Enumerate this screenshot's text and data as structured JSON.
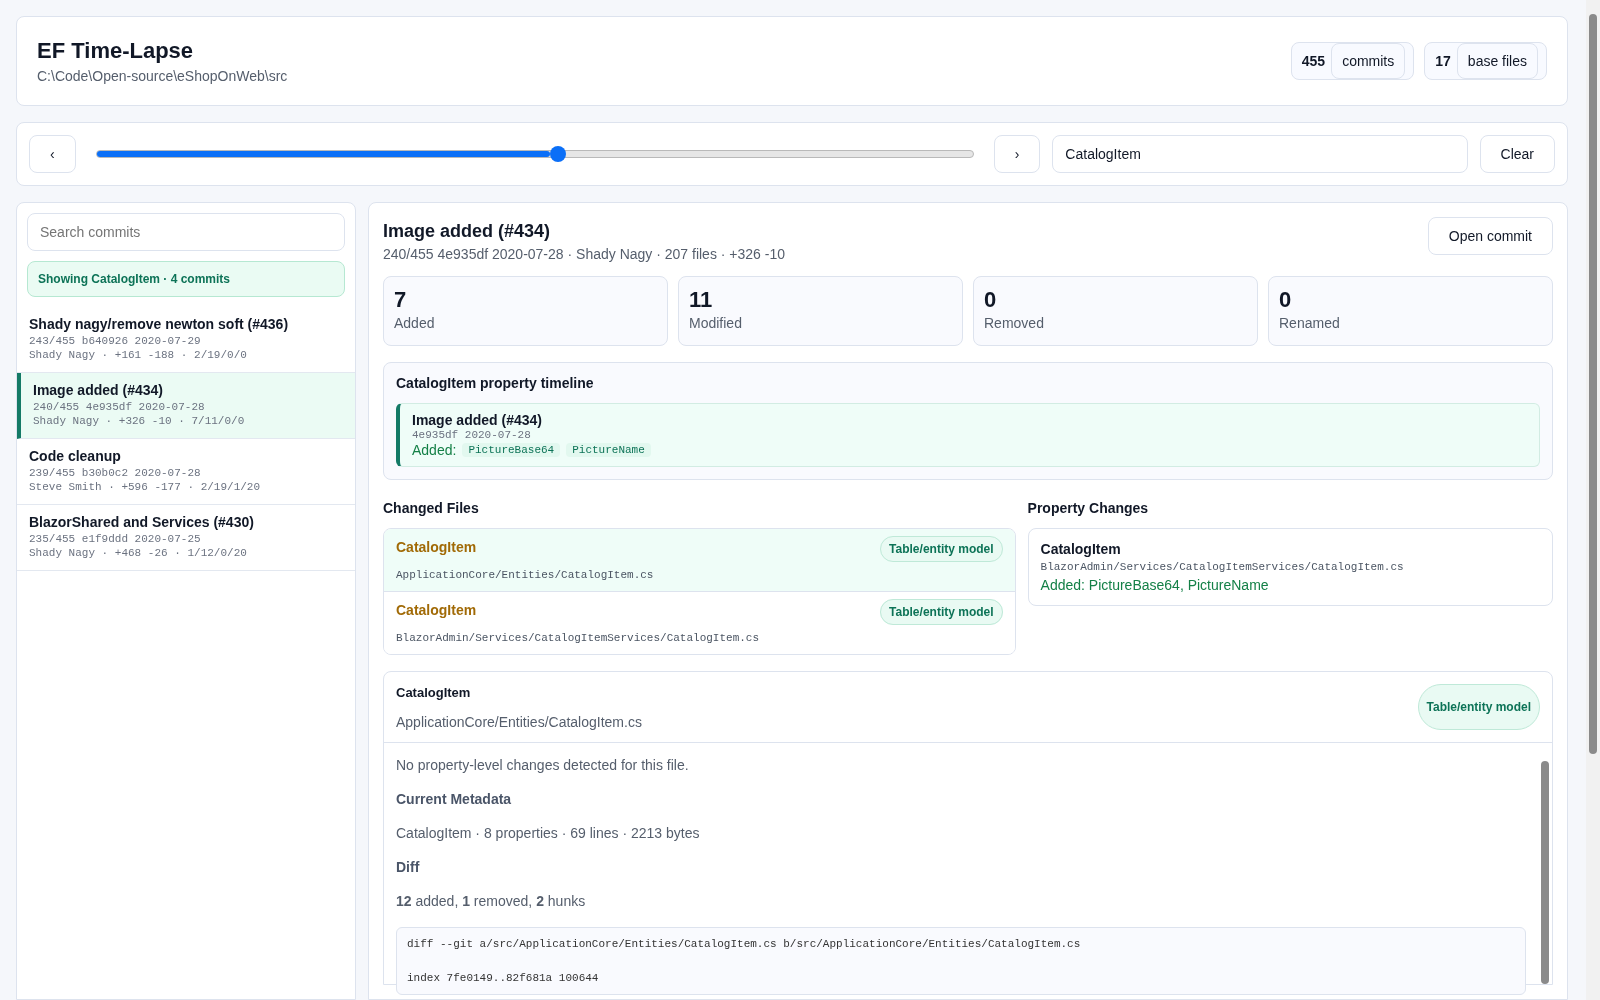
{
  "header": {
    "title": "EF Time-Lapse",
    "path": "C:\\Code\\Open-source\\eShopOnWeb\\src",
    "stats": [
      {
        "value": "455",
        "label": "commits"
      },
      {
        "value": "17",
        "label": "base files"
      }
    ]
  },
  "toolbar": {
    "prev": "‹",
    "next": "›",
    "slider": {
      "level": 0.527
    },
    "filter": {
      "value": "CatalogItem"
    },
    "clear": "Clear"
  },
  "sidebar": {
    "search": {
      "placeholder": "Search commits"
    },
    "banner": "Showing CatalogItem · 4 commits",
    "commits": [
      {
        "title": "Shady nagy/remove newton soft (#436)",
        "line1": "243/455 b640926 2020-07-29",
        "line2": "Shady Nagy · +161 -188 · 2/19/0/0",
        "selected": false
      },
      {
        "title": "Image added (#434)",
        "line1": "240/455 4e935df 2020-07-28",
        "line2": "Shady Nagy · +326 -10 · 7/11/0/0",
        "selected": true
      },
      {
        "title": "Code cleanup",
        "line1": "239/455 b30b0c2 2020-07-28",
        "line2": "Steve Smith · +596 -177 · 2/19/1/20",
        "selected": false
      },
      {
        "title": "BlazorShared and Services (#430)",
        "line1": "235/455 e1f9ddd 2020-07-25",
        "line2": "Shady Nagy · +468 -26 · 1/12/0/20",
        "selected": false
      }
    ]
  },
  "detail": {
    "title": "Image added (#434)",
    "meta": "240/455 4e935df 2020-07-28 · Shady Nagy · 207 files · +326 -10",
    "open_button": "Open commit",
    "counts": [
      {
        "value": "7",
        "label": "Added"
      },
      {
        "value": "11",
        "label": "Modified"
      },
      {
        "value": "0",
        "label": "Removed"
      },
      {
        "value": "0",
        "label": "Renamed"
      }
    ],
    "timeline": {
      "title": "CatalogItem property timeline",
      "entries": [
        {
          "title": "Image added (#434)",
          "meta": "4e935df 2020-07-28",
          "label": "Added:",
          "tags": [
            "PictureBase64",
            "PictureName"
          ]
        }
      ]
    },
    "changed_files": {
      "heading": "Changed Files",
      "files": [
        {
          "name": "CatalogItem",
          "path": "ApplicationCore/Entities/CatalogItem.cs",
          "tag": "Table/entity model",
          "selected": true
        },
        {
          "name": "CatalogItem",
          "path": "BlazorAdmin/Services/CatalogItemServices/CatalogItem.cs",
          "tag": "Table/entity model",
          "selected": false
        }
      ]
    },
    "property_changes": {
      "heading": "Property Changes",
      "items": [
        {
          "name": "CatalogItem",
          "path": "BlazorAdmin/Services/CatalogItemServices/CatalogItem.cs",
          "summary": "Added: PictureBase64, PictureName"
        }
      ]
    },
    "file_detail": {
      "name": "CatalogItem",
      "path": "ApplicationCore/Entities/CatalogItem.cs",
      "tag": "Table/entity model",
      "message": "No property-level changes detected for this file.",
      "metadata_heading": "Current Metadata",
      "metadata": "CatalogItem · 8 properties · 69 lines · 2213 bytes",
      "diff_heading": "Diff",
      "diff_summary": "**12** added, **1** removed, **2** hunks",
      "diff_lines": [
        "diff --git a/src/ApplicationCore/Entities/CatalogItem.cs b/src/ApplicationCore/Entities/CatalogItem.cs",
        "index 7fe0149..82f681a 100644"
      ]
    }
  }
}
